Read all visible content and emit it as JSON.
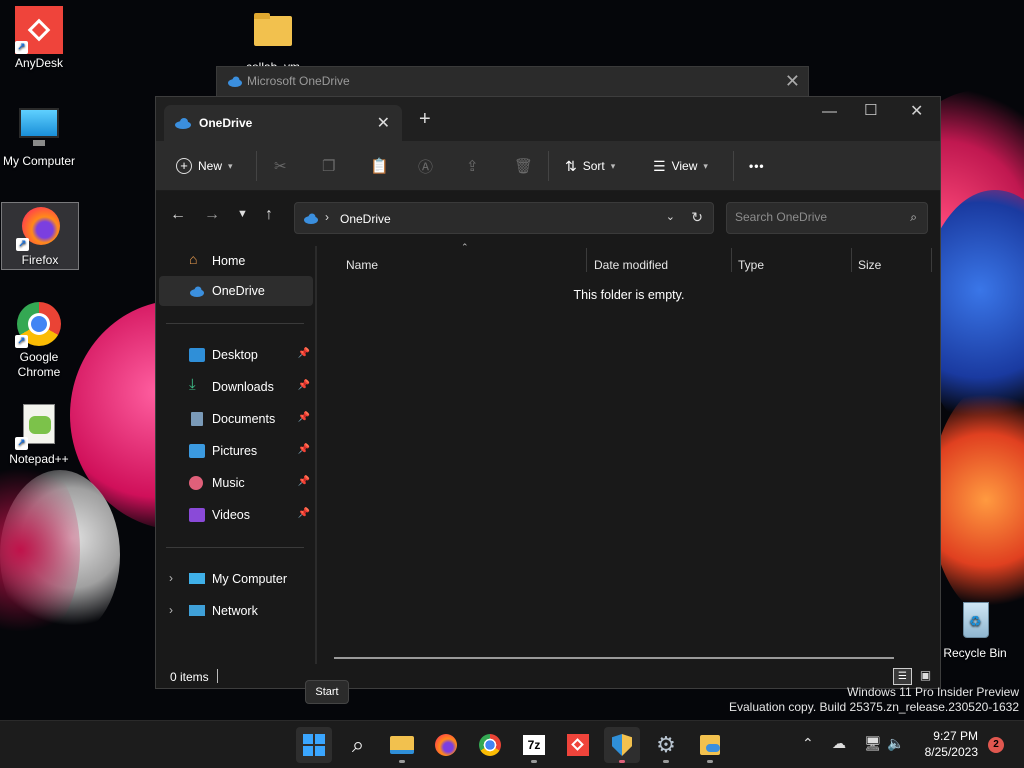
{
  "desktop": {
    "icons": [
      {
        "label": "AnyDesk"
      },
      {
        "label": "My Computer"
      },
      {
        "label": "Firefox"
      },
      {
        "label": "Google Chrome"
      },
      {
        "label": "Notepad++"
      },
      {
        "label": "collab_vm"
      },
      {
        "label": "Recycle Bin"
      }
    ],
    "watermark": [
      "Windows 11 Pro Insider Preview",
      "Evaluation copy. Build 25375.zn_release.230520-1632"
    ]
  },
  "back_window": {
    "title": "Microsoft OneDrive"
  },
  "explorer": {
    "tab_title": "OneDrive",
    "toolbar": {
      "new_label": "New",
      "sort_label": "Sort",
      "view_label": "View",
      "more_label": "•••"
    },
    "address": {
      "crumb": "OneDrive"
    },
    "search": {
      "placeholder": "Search OneDrive"
    },
    "nav": {
      "home": "Home",
      "onedrive": "OneDrive",
      "quick": [
        {
          "label": "Desktop"
        },
        {
          "label": "Downloads"
        },
        {
          "label": "Documents"
        },
        {
          "label": "Pictures"
        },
        {
          "label": "Music"
        },
        {
          "label": "Videos"
        }
      ],
      "my_computer": "My Computer",
      "network": "Network"
    },
    "columns": {
      "name": "Name",
      "date": "Date modified",
      "type": "Type",
      "size": "Size"
    },
    "empty_message": "This folder is empty.",
    "status": {
      "items": "0 items"
    }
  },
  "tooltip": "Start",
  "taskbar": {
    "clock_time": "9:27 PM",
    "clock_date": "8/25/2023",
    "notification_count": "2",
    "apps": [
      "start",
      "search",
      "file-explorer",
      "firefox",
      "chrome",
      "7zip",
      "anydesk",
      "windows-security",
      "settings",
      "onedrive"
    ]
  }
}
